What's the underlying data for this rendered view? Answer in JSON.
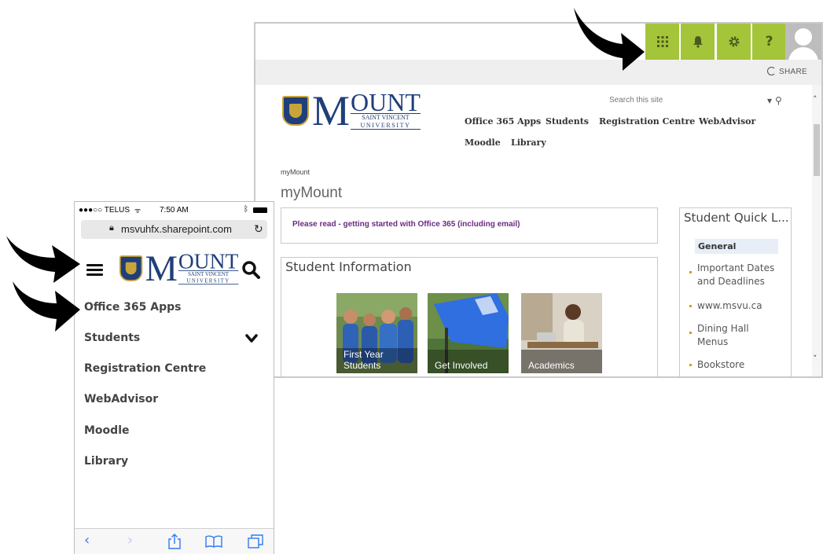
{
  "desktop": {
    "suite": {
      "app_launcher_icon": "waffle-icon",
      "notification_icon": "bell-icon",
      "settings_icon": "gear-icon",
      "help_label": "?",
      "accent_color": "#a4c43a"
    },
    "share_label": "SHARE",
    "logo": {
      "big": "M",
      "ount": "OUNT",
      "line1": "SAINT VINCENT",
      "line2": "UNIVERSITY"
    },
    "search_placeholder": "Search this site",
    "nav": [
      "Office 365 Apps",
      "Students",
      "Registration Centre",
      "WebAdvisor",
      "Moodle",
      "Library"
    ],
    "breadcrumb": "myMount",
    "page_title": "myMount",
    "notice_link": "Please read - getting started with Office 365 (including email)",
    "student_info": {
      "title": "Student Information",
      "tiles": [
        {
          "line1": "First Year",
          "line2": "Students"
        },
        {
          "line1": "Get Involved",
          "line2": ""
        },
        {
          "line1": "Academics",
          "line2": ""
        }
      ]
    },
    "quick_links": {
      "title": "Student Quick L...",
      "general": "General",
      "items": [
        {
          "line1": "Important Dates",
          "line2": "and Deadlines"
        },
        {
          "line1": "www.msvu.ca",
          "line2": ""
        },
        {
          "line1": "Dining Hall",
          "line2": "Menus"
        },
        {
          "line1": "Bookstore",
          "line2": ""
        }
      ]
    }
  },
  "phone": {
    "status": {
      "carrier": "●●●○○ TELUS",
      "time": "7:50 AM"
    },
    "url": "msvuhfx.sharepoint.com",
    "nav": [
      "Office 365 Apps",
      "Students",
      "Registration Centre",
      "WebAdvisor",
      "Moodle",
      "Library"
    ],
    "toolbar_icons": [
      "back-icon",
      "forward-icon",
      "share-icon",
      "bookmarks-icon",
      "tabs-icon"
    ]
  }
}
